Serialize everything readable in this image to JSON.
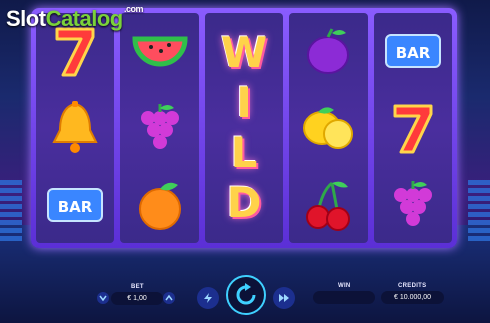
{
  "branding": {
    "logo_slot": "Slot",
    "logo_catalog": "Catalog",
    "logo_domain": ".com"
  },
  "reels": [
    [
      "seven",
      "watermelon",
      "bell",
      "grapes",
      "bar",
      "orange"
    ],
    [
      "wild"
    ],
    [
      "plum",
      "lemon",
      "cherries"
    ],
    [
      "bar",
      "seven",
      "grapes"
    ]
  ],
  "wild_letters": [
    "W",
    "I",
    "L",
    "D"
  ],
  "controls": {
    "bet_label": "BET",
    "bet_value": "€ 1,00",
    "win_label": "WIN",
    "win_value": "",
    "credits_label": "CREDITS",
    "credits_value": "€ 10.000,00"
  },
  "colors": {
    "accent": "#3fd0ff",
    "frame": "#7a4cf0",
    "reel": "#3b2a8a"
  }
}
